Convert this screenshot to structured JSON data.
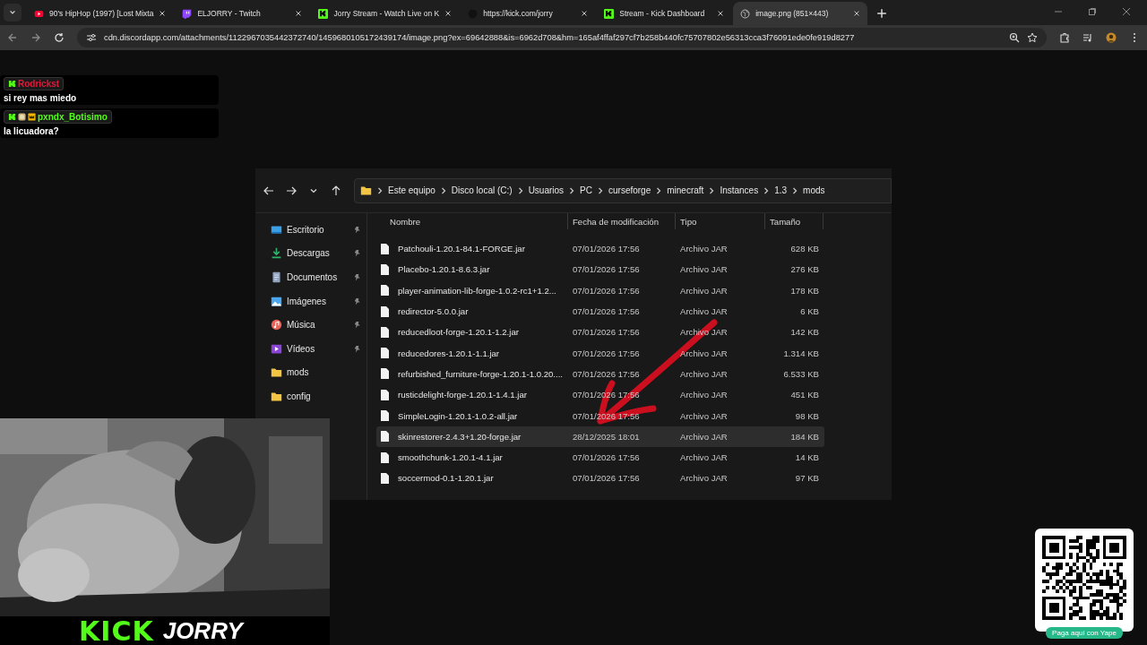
{
  "browser": {
    "tabs": [
      {
        "kind": "youtube",
        "title": "90's HipHop (1997) [Lost Mixta",
        "selected": false
      },
      {
        "kind": "twitch",
        "title": "ELJORRY - Twitch",
        "selected": false
      },
      {
        "kind": "kick",
        "title": "Jorry Stream - Watch Live on K",
        "selected": false
      },
      {
        "kind": "blank",
        "title": "https://kick.com/jorry",
        "selected": false
      },
      {
        "kind": "kick",
        "title": "Stream - Kick Dashboard",
        "selected": false
      },
      {
        "kind": "globe",
        "title": "image.png (851×443)",
        "selected": true
      }
    ],
    "url": "cdn.discordapp.com/attachments/1122967035442372740/1459680105172439174/image.png?ex=69642888&is=6962d708&hm=165af4ffaf297cf7b258b440fc75707802e56313cca3f76091ede0fe919d8277"
  },
  "chat": [
    {
      "username": "Rodrickst",
      "color": "#e0193a",
      "kind": "viewer",
      "message": "si rey mas miedo"
    },
    {
      "username": "pxndx_Botisimo",
      "color": "#53fc18",
      "kind": "subscriber",
      "message": "la licuadora?"
    }
  ],
  "explorer": {
    "breadcrumb": [
      "Este equipo",
      "Disco local (C:)",
      "Usuarios",
      "PC",
      "curseforge",
      "minecraft",
      "Instances",
      "1.3",
      "mods"
    ],
    "sidebar": [
      {
        "label": "Escritorio",
        "kind": "desktop",
        "pinned": true
      },
      {
        "label": "Descargas",
        "kind": "download",
        "pinned": true
      },
      {
        "label": "Documentos",
        "kind": "documents",
        "pinned": true
      },
      {
        "label": "Imágenes",
        "kind": "pictures",
        "pinned": true
      },
      {
        "label": "Música",
        "kind": "music",
        "pinned": true
      },
      {
        "label": "Vídeos",
        "kind": "videos",
        "pinned": true
      },
      {
        "label": "mods",
        "kind": "folder",
        "pinned": false
      },
      {
        "label": "config",
        "kind": "folder",
        "pinned": false
      }
    ],
    "columns": [
      "Nombre",
      "Fecha de modificación",
      "Tipo",
      "Tamaño"
    ],
    "rows": [
      {
        "name": "Patchouli-1.20.1-84.1-FORGE.jar",
        "modified": "07/01/2026 17:56",
        "type": "Archivo JAR",
        "size": "628 KB",
        "selected": false
      },
      {
        "name": "Placebo-1.20.1-8.6.3.jar",
        "modified": "07/01/2026 17:56",
        "type": "Archivo JAR",
        "size": "276 KB",
        "selected": false
      },
      {
        "name": "player-animation-lib-forge-1.0.2-rc1+1.2...",
        "modified": "07/01/2026 17:56",
        "type": "Archivo JAR",
        "size": "178 KB",
        "selected": false
      },
      {
        "name": "redirector-5.0.0.jar",
        "modified": "07/01/2026 17:56",
        "type": "Archivo JAR",
        "size": "6 KB",
        "selected": false
      },
      {
        "name": "reducedloot-forge-1.20.1-1.2.jar",
        "modified": "07/01/2026 17:56",
        "type": "Archivo JAR",
        "size": "142 KB",
        "selected": false
      },
      {
        "name": "reducedores-1.20.1-1.1.jar",
        "modified": "07/01/2026 17:56",
        "type": "Archivo JAR",
        "size": "1.314 KB",
        "selected": false
      },
      {
        "name": "refurbished_furniture-forge-1.20.1-1.0.20....",
        "modified": "07/01/2026 17:56",
        "type": "Archivo JAR",
        "size": "6.533 KB",
        "selected": false
      },
      {
        "name": "rusticdelight-forge-1.20.1-1.4.1.jar",
        "modified": "07/01/2026 17:56",
        "type": "Archivo JAR",
        "size": "451 KB",
        "selected": false
      },
      {
        "name": "SimpleLogin-1.20.1-1.0.2-all.jar",
        "modified": "07/01/2026 17:56",
        "type": "Archivo JAR",
        "size": "98 KB",
        "selected": false
      },
      {
        "name": "skinrestorer-2.4.3+1.20-forge.jar",
        "modified": "28/12/2025 18:01",
        "type": "Archivo JAR",
        "size": "184 KB",
        "selected": true
      },
      {
        "name": "smoothchunk-1.20.1-4.1.jar",
        "modified": "07/01/2026 17:56",
        "type": "Archivo JAR",
        "size": "14 KB",
        "selected": false
      },
      {
        "name": "soccermod-0.1-1.20.1.jar",
        "modified": "07/01/2026 17:56",
        "type": "Archivo JAR",
        "size": "97 KB",
        "selected": false
      }
    ]
  },
  "overlay": {
    "brand": "KICK",
    "channel": "JORRY",
    "qr_caption": "Paga aquí con Yape"
  }
}
